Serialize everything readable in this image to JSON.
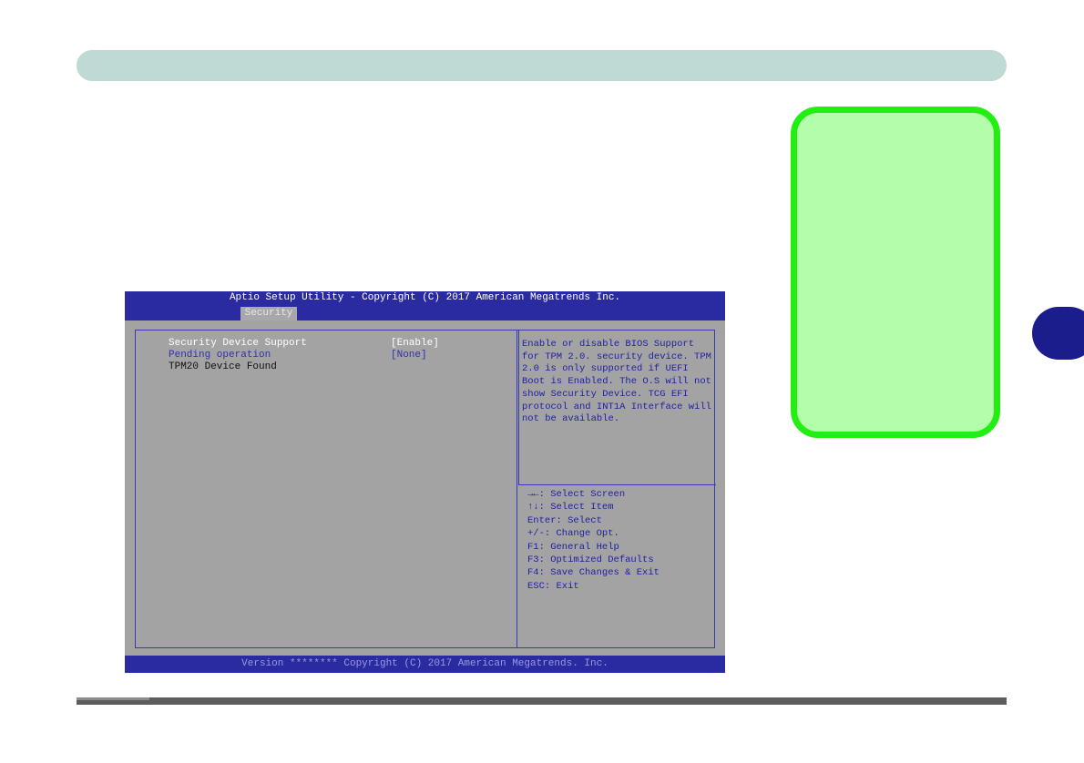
{
  "bios": {
    "title": "Aptio Setup Utility - Copyright (C) 2017 American Megatrends Inc.",
    "tab": "Security",
    "items": [
      {
        "label": "Security Device Support",
        "value": "[Enable]"
      },
      {
        "label": "Pending operation",
        "value": "[None]"
      },
      {
        "label": "TPM20 Device Found",
        "value": ""
      }
    ],
    "help": "Enable or disable BIOS Support for TPM 2.0. security device. TPM 2.0 is only supported if UEFI Boot is Enabled. The O.S will not show Security Device. TCG EFI protocol and INT1A Interface will not be available.",
    "keys": [
      "→←: Select Screen",
      "↑↓: Select Item",
      "Enter: Select",
      "+/-: Change Opt.",
      "F1: General Help",
      "F3: Optimized Defaults",
      "F4: Save Changes & Exit",
      "ESC: Exit"
    ],
    "footer": "Version ******** Copyright (C) 2017 American Megatrends. Inc."
  },
  "colors": {
    "header_bar": "#bfd9d4",
    "callout_border": "#22ee11",
    "callout_fill": "#b4fdab",
    "chapter_tab": "#1b1d8d",
    "bios_blue": "#2a2ba0",
    "bios_gray": "#a3a3a3"
  }
}
